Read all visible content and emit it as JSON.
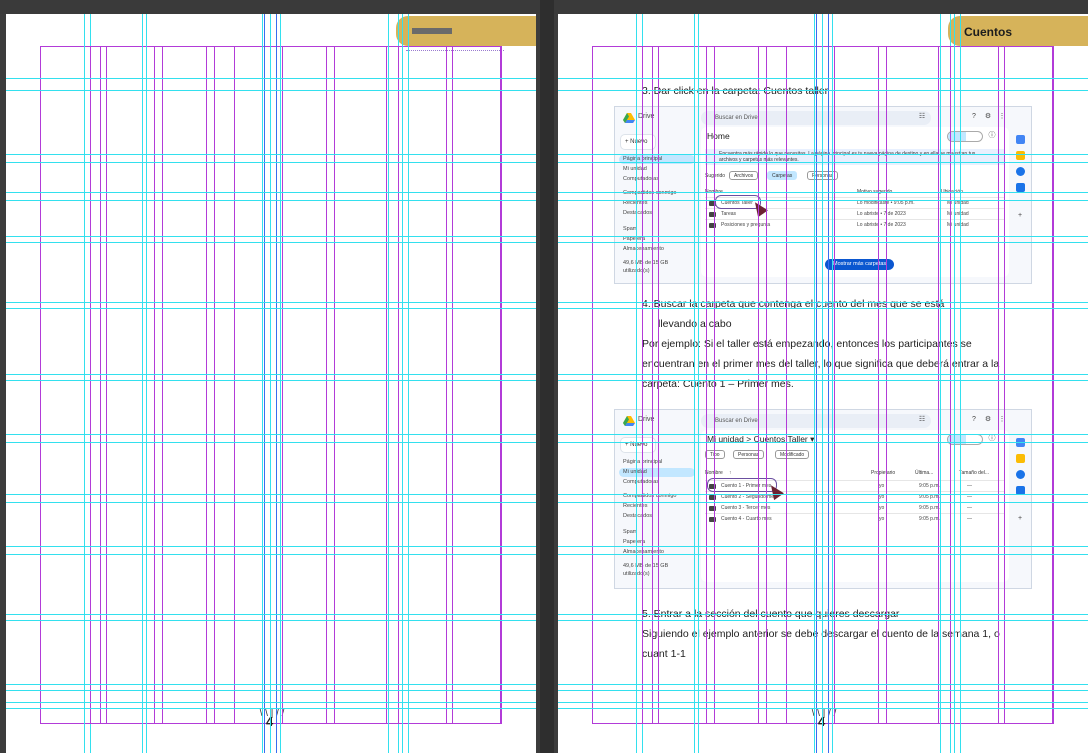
{
  "left_page": {
    "page_number": "4"
  },
  "right_page": {
    "header_tab": "Cuentos",
    "page_number": "4",
    "steps": [
      {
        "heading": "3. Dar click en la carpeta: Cuentos taller"
      },
      {
        "heading_line1": "4. Buscar la carpeta que contenga el cuento del mes que se está",
        "heading_line2": "llevando a cabo",
        "body": [
          "Por ejemplo: Si el taller está empezando, entonces los participantes se",
          "encuentran en el primer mes del taller, lo que significa que deberá entrar a la",
          "carpeta: Cuento 1 – Primer mes."
        ]
      },
      {
        "heading": "5. Entrar a la sección del cuento que quieres descargar",
        "body": [
          "Siguiendo el ejemplo anterior se debe descargar el cuento de la semana 1, o",
          "cuant 1-1"
        ]
      }
    ]
  },
  "screenshot1": {
    "brand": "Drive",
    "search_placeholder": "Buscar en Drive",
    "new_button": "Nuevo",
    "sidebar": [
      "Página principal",
      "Mi unidad",
      "Computadoras",
      "Compartidos conmigo",
      "Recientes",
      "Destacados",
      "Spam",
      "Papelera",
      "Almacenamiento",
      "49,6 MB de 15 GB",
      "utilizado(s)"
    ],
    "title": "Home",
    "banner": "Encuentra más rápido lo que necesitas. La página principal es tu nueva página de destino y en ella se muestran tus archivos y carpetas más relevantes.",
    "suggested_label": "Sugerido",
    "chips": [
      "Archivos",
      "Carpetas",
      "Personas"
    ],
    "columns": [
      "Nombre",
      "Motivo sugerido",
      "Ubicación"
    ],
    "rows": [
      {
        "name": "Cuentos Taller",
        "reason": "Lo modificaste • 9:05 p.m.",
        "location": "Mi unidad"
      },
      {
        "name": "Tareas",
        "reason": "Lo abriste • 7 de 2023",
        "location": "Mi unidad"
      },
      {
        "name": "Posiciones y pregunta",
        "reason": "Lo abriste • 7 de 2023",
        "location": "Mi unidad"
      }
    ],
    "more_button": "Mostrar más carpetas"
  },
  "screenshot2": {
    "brand": "Drive",
    "search_placeholder": "Buscar en Drive",
    "new_button": "Nuevo",
    "sidebar": [
      "Página principal",
      "Mi unidad",
      "Computadoras",
      "Compartidos conmigo",
      "Recientes",
      "Destacados",
      "Spam",
      "Papelera",
      "Almacenamiento",
      "49,6 MB de 15 GB",
      "utilizado(s)"
    ],
    "breadcrumb_root": "Mi unidad",
    "breadcrumb_sep": ">",
    "breadcrumb_current": "Cuentos Taller",
    "chips": [
      "Tipo",
      "Personas",
      "Modificado"
    ],
    "columns": [
      "Nombre",
      "Propietario",
      "Última...",
      "Tamaño del..."
    ],
    "rows": [
      {
        "name": "Cuento 1 - Primer mes",
        "owner": "yo",
        "modified": "9:05 p.m.",
        "size": "—"
      },
      {
        "name": "Cuento 2 - Segundo mes",
        "owner": "yo",
        "modified": "9:05 p.m.",
        "size": "—"
      },
      {
        "name": "Cuento 3 - Tercer mes",
        "owner": "yo",
        "modified": "9:05 p.m.",
        "size": "—"
      },
      {
        "name": "Cuento 4 - Cuarto mes",
        "owner": "yo",
        "modified": "9:05 p.m.",
        "size": "—"
      }
    ]
  },
  "colors": {
    "tab": "#d6b35a",
    "grid_cyan": "#33e0ee",
    "grid_magenta": "#b23bd8",
    "grid_blue": "#3a6cf0",
    "drive_blue": "#0b57d0"
  }
}
